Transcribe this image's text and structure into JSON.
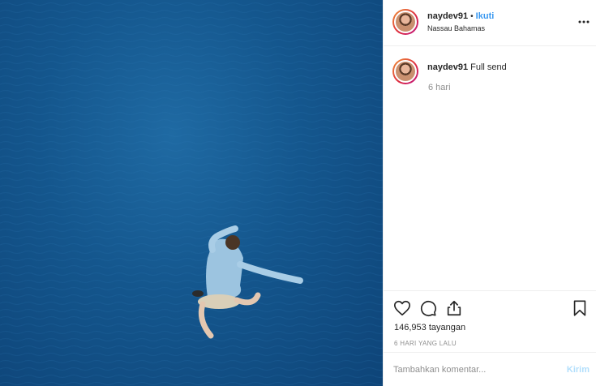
{
  "post": {
    "author": {
      "username": "naydev91",
      "separator": "•",
      "follow_label": "Ikuti",
      "location": "Nassau Bahamas"
    },
    "caption": {
      "username": "naydev91",
      "text": "Full send",
      "time": "6 hari"
    },
    "stats": {
      "views": "146,953 tayangan",
      "time_ago": "6 HARI YANG LALU"
    },
    "comment_box": {
      "placeholder": "Tambahkan komentar...",
      "send_label": "Kirim"
    }
  },
  "icons": {
    "more": "more-options-icon",
    "like": "heart-icon",
    "comment": "comment-icon",
    "share": "share-icon",
    "save": "bookmark-icon"
  },
  "colors": {
    "link_blue": "#3897f0",
    "send_disabled": "#b2dffc",
    "muted": "#8e8e8e",
    "water": "#14568d"
  }
}
